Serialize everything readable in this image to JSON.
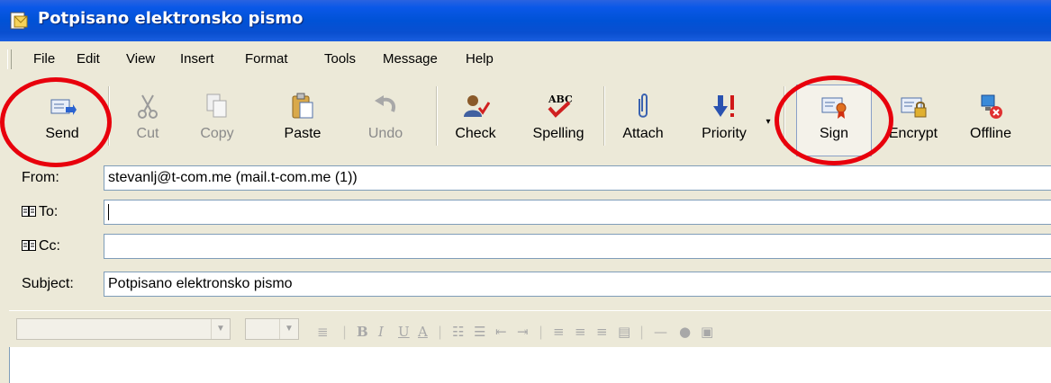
{
  "window": {
    "title": "Potpisano elektronsko pismo"
  },
  "menu": [
    "File",
    "Edit",
    "View",
    "Insert",
    "Format",
    "Tools",
    "Message",
    "Help"
  ],
  "toolbar": {
    "send": "Send",
    "cut": "Cut",
    "copy": "Copy",
    "paste": "Paste",
    "undo": "Undo",
    "check": "Check",
    "spelling": "Spelling",
    "attach": "Attach",
    "priority": "Priority",
    "sign": "Sign",
    "encrypt": "Encrypt",
    "offline": "Offline"
  },
  "fields": {
    "from_label": "From:",
    "from_value": "stevanlj@t-com.me    (mail.t-com.me (1))",
    "to_label": "To:",
    "to_value": "",
    "cc_label": "Cc:",
    "cc_value": "",
    "subject_label": "Subject:",
    "subject_value": "Potpisano elektronsko pismo"
  },
  "format_icons": [
    "align-icon",
    "bold-icon",
    "italic-icon",
    "underline-icon",
    "font-color-icon",
    "numbered-list-icon",
    "bullet-list-icon",
    "decrease-indent-icon",
    "increase-indent-icon",
    "align-left-icon",
    "center-icon",
    "align-right-icon",
    "justify-icon",
    "horizontal-line-icon",
    "insert-link-icon",
    "insert-picture-icon"
  ],
  "highlight_color": "#e8000c"
}
